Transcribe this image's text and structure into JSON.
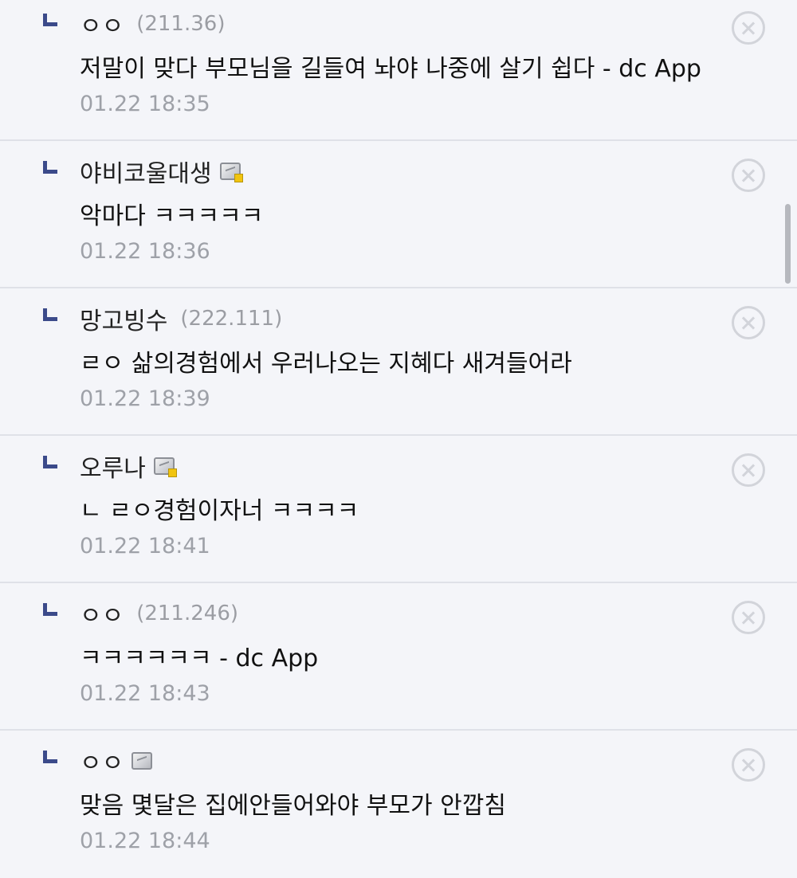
{
  "comments": [
    {
      "author": "ㅇㅇ",
      "ip": "(211.36)",
      "badge": "",
      "text": "저말이 맞다 부모님을 길들여 놔야 나중에 살기 쉽다 - dc App",
      "date": "01.22 18:35"
    },
    {
      "author": "야비코울대생",
      "ip": "",
      "badge": "gallery-badge-gold",
      "text": "악마다 ㅋㅋㅋㅋㅋ",
      "date": "01.22 18:36"
    },
    {
      "author": "망고빙수",
      "ip": "(222.111)",
      "badge": "",
      "text": "ㄹㅇ 삶의경험에서 우러나오는 지혜다 새겨들어라",
      "date": "01.22 18:39"
    },
    {
      "author": "오루나",
      "ip": "",
      "badge": "gallery-badge-gold",
      "text": "ㄴ ㄹㅇ경험이자너 ㅋㅋㅋㅋ",
      "date": "01.22 18:41"
    },
    {
      "author": "ㅇㅇ",
      "ip": "(211.246)",
      "badge": "",
      "text": "ㅋㅋㅋㅋㅋㅋ - dc App",
      "date": "01.22 18:43"
    },
    {
      "author": "ㅇㅇ",
      "ip": "",
      "badge": "gallery-badge-plain",
      "text": "맞음 몇달은 집에안들어와야 부모가 안깝침",
      "date": "01.22 18:44"
    }
  ],
  "icons": {
    "reply": "reply-arrow-icon",
    "delete": "close-circle-icon"
  },
  "colors": {
    "background": "#f4f5f9",
    "reply_mark": "#3b4a8a",
    "meta_text": "#9ea1a8",
    "divider": "#dfe1e8"
  }
}
